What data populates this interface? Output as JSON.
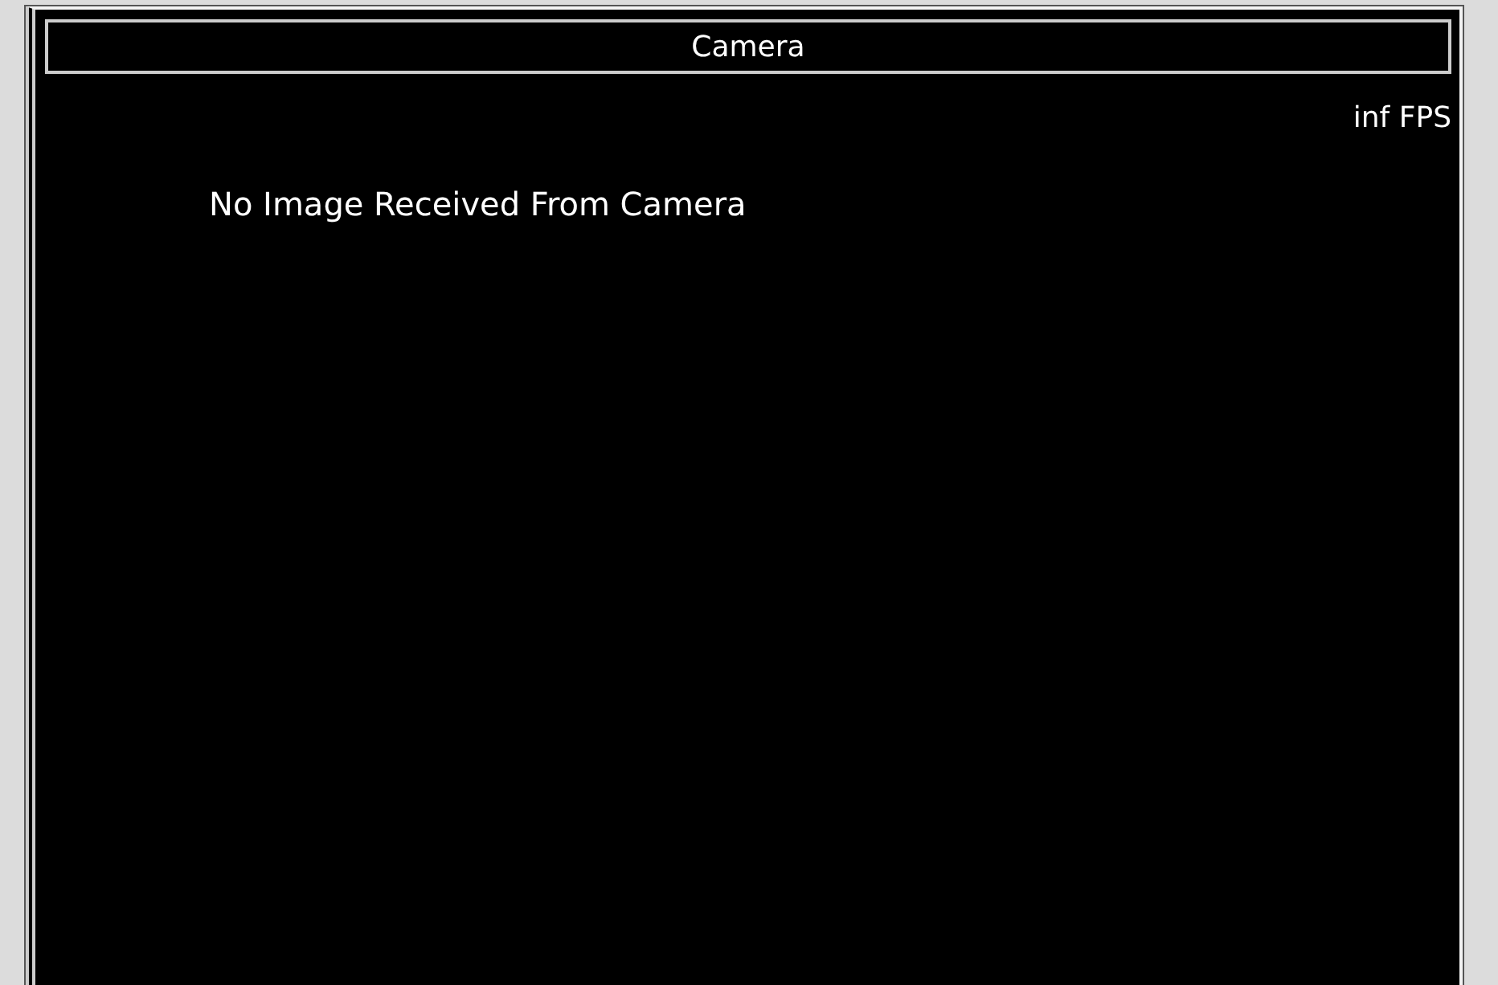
{
  "window": {
    "title": "Camera"
  },
  "fps": "inf FPS",
  "message": "No Image Received From Camera"
}
